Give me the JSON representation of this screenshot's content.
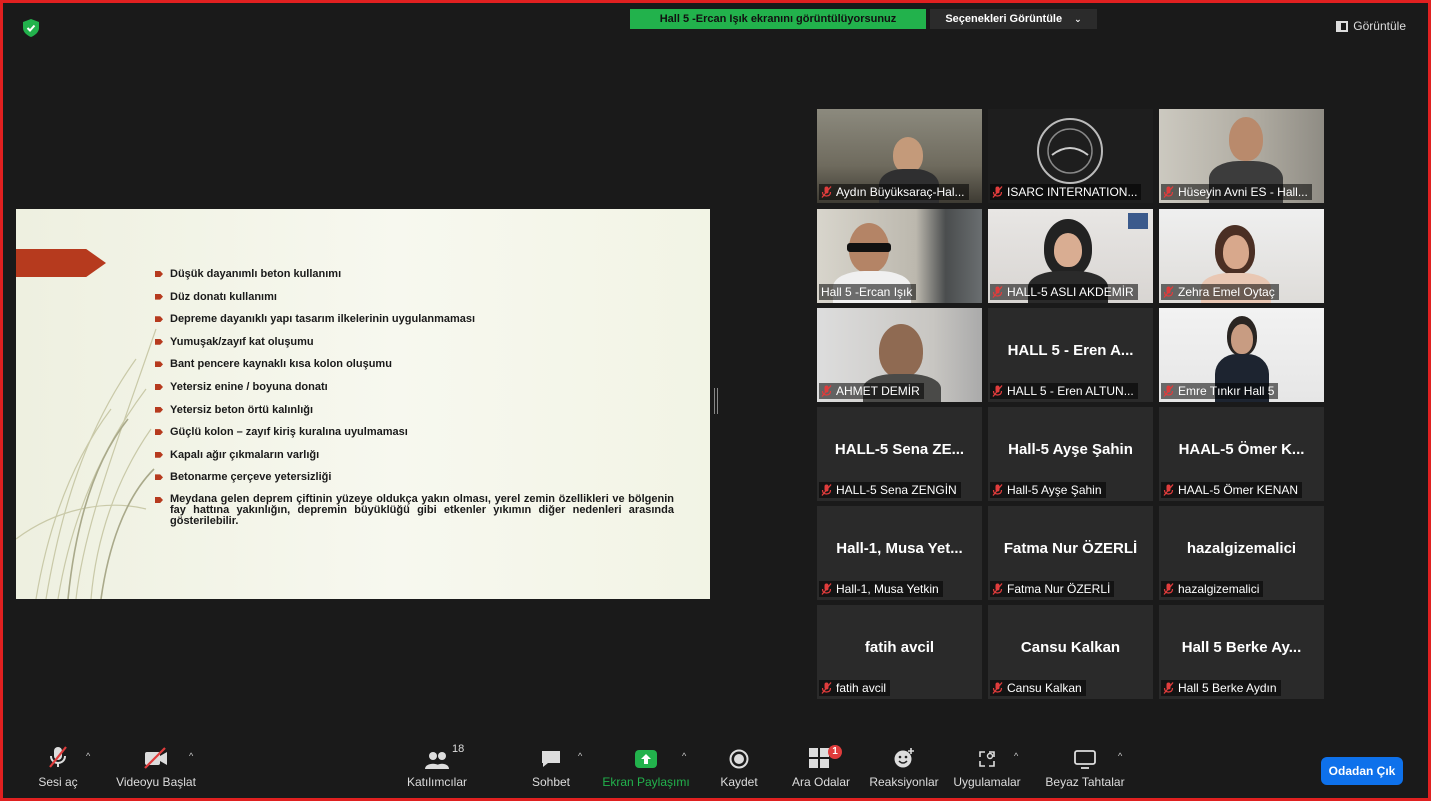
{
  "top": {
    "share_banner": "Hall 5 -Ercan Işık ekranını görüntülüyorsunuz",
    "view_options": "Seçenekleri Görüntüle",
    "view_toggle": "Görüntüle"
  },
  "slide": {
    "bullets": [
      "Düşük dayanımlı beton kullanımı",
      "Düz donatı kullanımı",
      "Depreme dayanıklı yapı tasarım ilkelerinin uygulanmaması",
      "Yumuşak/zayıf kat oluşumu",
      "Bant pencere kaynaklı kısa kolon oluşumu",
      "Yetersiz enine / boyuna donatı",
      "Yetersiz beton örtü kalınlığı",
      "Güçlü kolon – zayıf kiriş kuralına uyulmaması",
      "Kapalı ağır çıkmaların varlığı",
      "Betonarme çerçeve yetersizliği",
      "Meydana gelen deprem çiftinin yüzeye oldukça yakın olması, yerel zemin özellikleri ve bölgenin fay hattına yakınlığın, depremin büyüklüğü gibi etkenler yıkımın diğer nedenleri arasında gösterilebilir."
    ]
  },
  "participants": [
    {
      "name": "Aydın Büyüksaraç-Hal...",
      "big": "",
      "muted": true
    },
    {
      "name": "ISARC INTERNATION...",
      "big": "",
      "muted": true
    },
    {
      "name": "Hüseyin Avni ES - Hall...",
      "big": "",
      "muted": true
    },
    {
      "name": "Hall 5 -Ercan Işık",
      "big": "",
      "muted": false
    },
    {
      "name": "HALL-5 ASLI AKDEMİR",
      "big": "",
      "muted": true
    },
    {
      "name": "Zehra Emel Oytaç",
      "big": "",
      "muted": true
    },
    {
      "name": "AHMET DEMİR",
      "big": "",
      "muted": true
    },
    {
      "name": "HALL 5 - Eren ALTUN...",
      "big": "HALL 5 - Eren A...",
      "muted": true
    },
    {
      "name": "Emre Tınkır Hall 5",
      "big": "",
      "muted": true
    },
    {
      "name": "HALL-5  Sena ZENGİN",
      "big": "HALL-5  Sena ZE...",
      "muted": true
    },
    {
      "name": "Hall-5 Ayşe Şahin",
      "big": "Hall-5 Ayşe Şahin",
      "muted": true
    },
    {
      "name": "HAAL-5 Ömer KENAN",
      "big": "HAAL-5 Ömer K...",
      "muted": true
    },
    {
      "name": "Hall-1, Musa Yetkin",
      "big": "Hall-1, Musa Yet...",
      "muted": true
    },
    {
      "name": "Fatma Nur ÖZERLİ",
      "big": "Fatma Nur ÖZERLİ",
      "muted": true
    },
    {
      "name": "hazalgizemalici",
      "big": "hazalgizemalici",
      "muted": true
    },
    {
      "name": "fatih avcil",
      "big": "fatih avcil",
      "muted": true
    },
    {
      "name": "Cansu Kalkan",
      "big": "Cansu Kalkan",
      "muted": true
    },
    {
      "name": "Hall 5 Berke Aydın",
      "big": "Hall 5 Berke Ay...",
      "muted": true
    }
  ],
  "toolbar": {
    "unmute": "Sesi aç",
    "start_video": "Videoyu Başlat",
    "participants": "Katılımcılar",
    "participant_count": "18",
    "chat": "Sohbet",
    "share": "Ekran Paylaşımı",
    "record": "Kaydet",
    "breakout": "Ara Odalar",
    "breakout_badge": "1",
    "reactions": "Reaksiyonlar",
    "apps": "Uygulamalar",
    "whiteboard": "Beyaz Tahtalar",
    "leave": "Odadan Çık"
  },
  "colors": {
    "frame": "#e02020",
    "share_green": "#22b24c",
    "leave_blue": "#0e71eb",
    "active_speaker": "#d9e66b",
    "slide_accent": "#b63a1e",
    "mute_red": "#e03c3c"
  }
}
